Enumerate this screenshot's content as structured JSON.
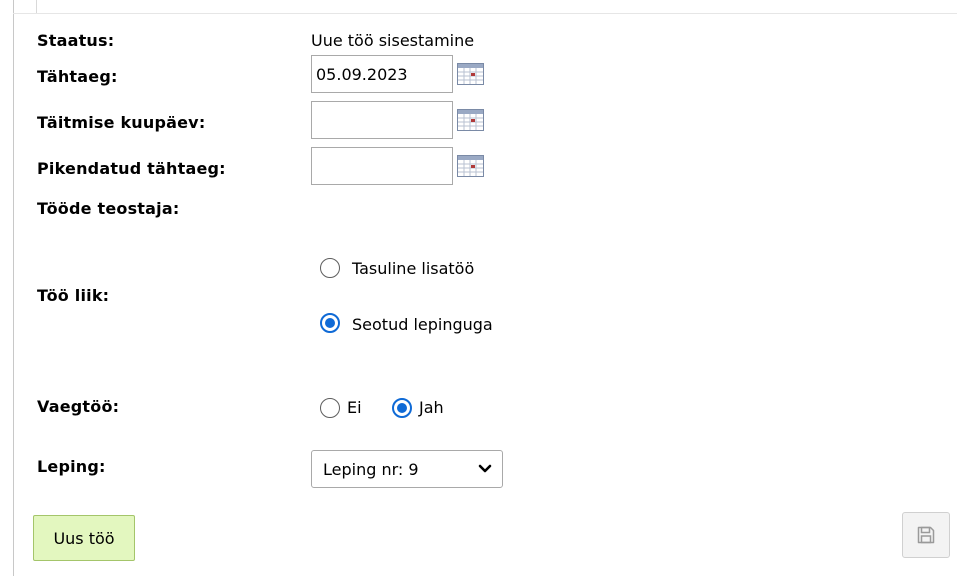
{
  "form": {
    "status": {
      "label": "Staatus:",
      "value": "Uue töö sisestamine"
    },
    "deadline": {
      "label": "Tähtaeg:",
      "value": "05.09.2023",
      "placeholder": ""
    },
    "completion_date": {
      "label": "Täitmise kuupäev:",
      "value": "",
      "placeholder": ""
    },
    "extended_deadline": {
      "label": "Pikendatud tähtaeg:",
      "value": "",
      "placeholder": ""
    },
    "performer": {
      "label": "Tööde teostaja:"
    },
    "work_type": {
      "label": "Töö liik:",
      "options": [
        {
          "label": "Tasuline lisatöö",
          "checked": false
        },
        {
          "label": "Seotud lepinguga",
          "checked": true
        }
      ]
    },
    "warranty_work": {
      "label": "Vaegtöö:",
      "options": [
        {
          "label": "Ei",
          "checked": false
        },
        {
          "label": "Jah",
          "checked": true
        }
      ]
    },
    "contract": {
      "label": "Leping:",
      "selected": "Leping nr: 9"
    }
  },
  "buttons": {
    "new_work": "Uus töö",
    "save_icon": "save-icon"
  },
  "icons": {
    "calendar": "calendar-icon",
    "chevron": "chevron-down-icon"
  },
  "colors": {
    "accent": "#0f6ad6",
    "new_button_bg": "#e3f7bf",
    "new_button_border": "#a4c56a"
  }
}
